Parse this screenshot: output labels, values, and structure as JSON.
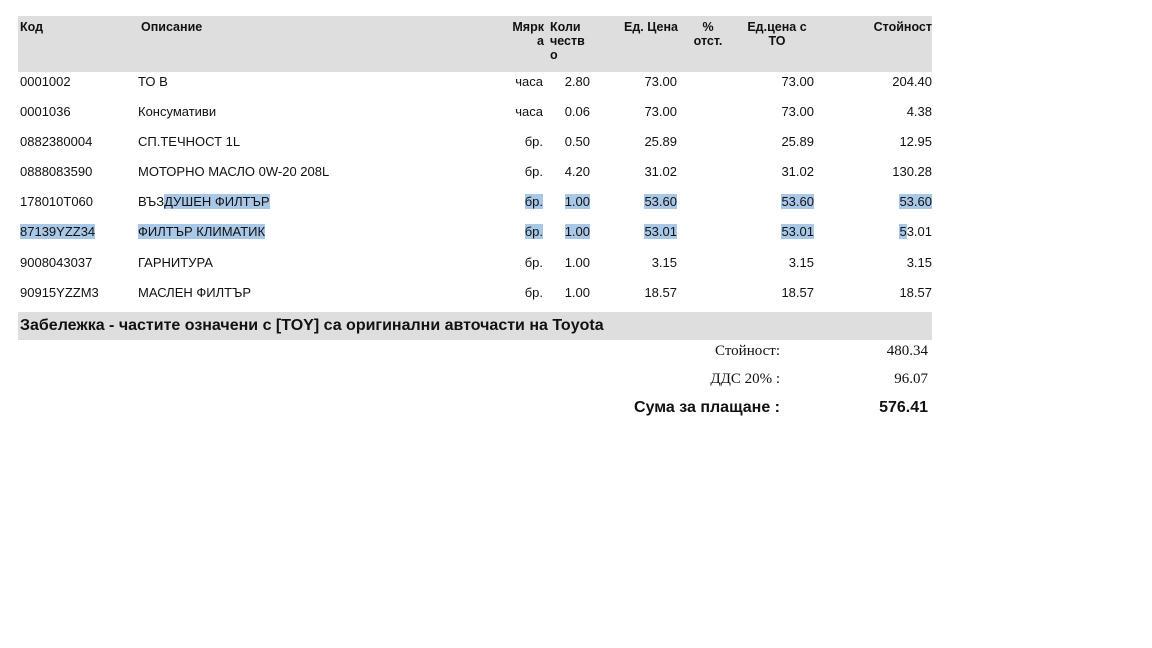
{
  "header": {
    "code": "Код",
    "description": "Описание",
    "unit": [
      "Мярк",
      "а"
    ],
    "quantity": [
      "Коли",
      "честв",
      "о"
    ],
    "unit_price": "Ед. Цена",
    "discount": [
      "%",
      "отст."
    ],
    "net_price": [
      "Ед.цена с",
      "ТО"
    ],
    "total": "Стойност"
  },
  "rows": [
    {
      "code": "0001002",
      "description": "ТО В",
      "unit": "часа",
      "quantity": "2.80",
      "unit_price": "73.00",
      "net_price": "73.00",
      "total": "204.40"
    },
    {
      "code": "0001036",
      "description": "Консумативи",
      "unit": "часа",
      "quantity": "0.06",
      "unit_price": "73.00",
      "net_price": "73.00",
      "total": "4.38"
    },
    {
      "code": "0882380004",
      "description": "СП.ТЕЧНОСТ 1L",
      "unit": "бр.",
      "quantity": "0.50",
      "unit_price": "25.89",
      "net_price": "25.89",
      "total": "12.95"
    },
    {
      "code": "0888083590",
      "description": "МОТОРНО МАСЛО 0W-20 208L",
      "unit": "бр.",
      "quantity": "4.20",
      "unit_price": "31.02",
      "net_price": "31.02",
      "total": "130.28"
    },
    {
      "code": "178010T060",
      "description": "ВЪЗДУШЕН ФИЛТЪР",
      "unit": "бр.",
      "quantity": "1.00",
      "unit_price": "53.60",
      "net_price": "53.60",
      "total": "53.60"
    },
    {
      "code": "87139YZZ34",
      "description": "ФИЛТЪР КЛИМАТИК",
      "unit": "бр.",
      "quantity": "1.00",
      "unit_price": "53.01",
      "net_price": "53.01",
      "total": "53.01"
    },
    {
      "code": "9008043037",
      "description": "ГАРНИТУРА",
      "unit": "бр.",
      "quantity": "1.00",
      "unit_price": "3.15",
      "net_price": "3.15",
      "total": "3.15"
    },
    {
      "code": "90915YZZM3",
      "description": "МАСЛЕН ФИЛТЪР",
      "unit": "бр.",
      "quantity": "1.00",
      "unit_price": "18.57",
      "net_price": "18.57",
      "total": "18.57"
    }
  ],
  "note": "Забележка - частите означени с [TOY] са оригинални авточасти на Toyota",
  "summary": {
    "subtotal_label": "Стойност:",
    "subtotal_value": "480.34",
    "vat_label": "ДДС 20%  :",
    "vat_value": "96.07",
    "total_label": "Сума за плащане :",
    "total_value": "576.41"
  },
  "colors": {
    "header_bg": "#dedede",
    "selection_highlight": "#a9c8e8"
  }
}
